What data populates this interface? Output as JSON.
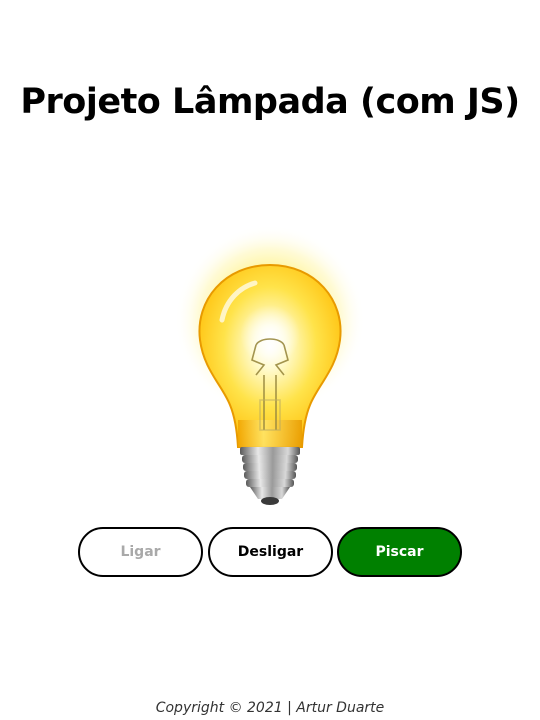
{
  "header": {
    "title": "Projeto Lâmpada (com JS)"
  },
  "lamp": {
    "state": "on",
    "icon": "lightbulb-on-icon"
  },
  "controls": {
    "ligar_label": "Ligar",
    "desligar_label": "Desligar",
    "piscar_label": "Piscar",
    "piscar_color": "#008000",
    "disabled_text_color": "#a9a9a9"
  },
  "footer": {
    "copyright": "Copyright © 2021 | Artur Duarte"
  }
}
